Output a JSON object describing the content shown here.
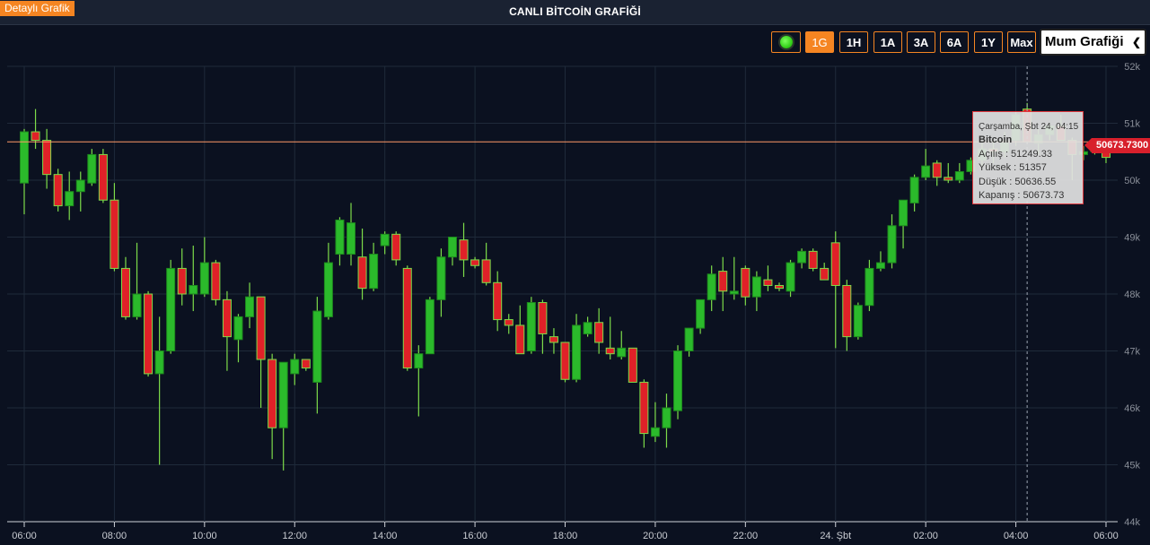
{
  "header": {
    "detail_button": "Detaylı Grafik",
    "title": "CANLI BİTCOİN GRAFİĞİ"
  },
  "toolbar": {
    "ranges": [
      "1G",
      "1H",
      "1A",
      "3A",
      "6A",
      "1Y",
      "Max"
    ],
    "active_range": "1G",
    "chart_type": "Mum Grafiği"
  },
  "tooltip": {
    "date": "Çarşamba, Şbt 24, 04:15",
    "name": "Bitcoin",
    "open": "Açılış : 51249.33",
    "high": "Yüksek : 51357",
    "low": "Düşük : 50636.55",
    "close": "Kapanış : 50673.73"
  },
  "price_tag": "50673.7300",
  "colors": {
    "up": "#2bba2b",
    "down": "#e02128",
    "wick": "#7ddc4a",
    "accent": "#f58522",
    "price_line": "#ff9966"
  },
  "chart_data": {
    "type": "candlestick",
    "title": "CANLI BİTCOİN GRAFİĞİ",
    "series_name": "Bitcoin",
    "ylim": [
      44000,
      52000
    ],
    "y_ticks": [
      "44k",
      "45k",
      "46k",
      "47k",
      "48k",
      "49k",
      "50k",
      "51k",
      "52k"
    ],
    "y_tick_values": [
      44000,
      45000,
      46000,
      47000,
      48000,
      49000,
      50000,
      51000,
      52000
    ],
    "x_ticks": [
      "06:00",
      "08:00",
      "10:00",
      "12:00",
      "14:00",
      "16:00",
      "18:00",
      "20:00",
      "22:00",
      "24. Şbt",
      "02:00",
      "04:00",
      "06:00"
    ],
    "x_tick_hours": [
      0,
      2,
      4,
      6,
      8,
      10,
      12,
      14,
      16,
      18,
      20,
      22,
      24
    ],
    "last_price": 50673.73,
    "crosshair_hour": 22.25,
    "candles": [
      {
        "t": 0,
        "o": 49950,
        "h": 50900,
        "l": 49400,
        "c": 50850
      },
      {
        "t": 0.25,
        "o": 50850,
        "h": 51250,
        "l": 50550,
        "c": 50700
      },
      {
        "t": 0.5,
        "o": 50700,
        "h": 50900,
        "l": 49850,
        "c": 50100
      },
      {
        "t": 0.75,
        "o": 50100,
        "h": 50200,
        "l": 49450,
        "c": 49550
      },
      {
        "t": 1,
        "o": 49550,
        "h": 50150,
        "l": 49300,
        "c": 49800
      },
      {
        "t": 1.25,
        "o": 49800,
        "h": 50150,
        "l": 49450,
        "c": 50000
      },
      {
        "t": 1.5,
        "o": 49950,
        "h": 50550,
        "l": 49900,
        "c": 50450
      },
      {
        "t": 1.75,
        "o": 50450,
        "h": 50550,
        "l": 49600,
        "c": 49650
      },
      {
        "t": 2,
        "o": 49650,
        "h": 49950,
        "l": 48400,
        "c": 48450
      },
      {
        "t": 2.25,
        "o": 48450,
        "h": 48650,
        "l": 47550,
        "c": 47600
      },
      {
        "t": 2.5,
        "o": 47600,
        "h": 48900,
        "l": 47550,
        "c": 48000
      },
      {
        "t": 2.75,
        "o": 48000,
        "h": 48050,
        "l": 46550,
        "c": 46600
      },
      {
        "t": 3,
        "o": 46600,
        "h": 47600,
        "l": 45000,
        "c": 47000
      },
      {
        "t": 3.25,
        "o": 47000,
        "h": 48600,
        "l": 46950,
        "c": 48450
      },
      {
        "t": 3.5,
        "o": 48450,
        "h": 48800,
        "l": 47800,
        "c": 48000
      },
      {
        "t": 3.75,
        "o": 48000,
        "h": 48850,
        "l": 47700,
        "c": 48150
      },
      {
        "t": 4,
        "o": 48000,
        "h": 49000,
        "l": 47950,
        "c": 48550
      },
      {
        "t": 4.25,
        "o": 48550,
        "h": 48600,
        "l": 47800,
        "c": 47900
      },
      {
        "t": 4.5,
        "o": 47900,
        "h": 48050,
        "l": 46650,
        "c": 47250
      },
      {
        "t": 4.75,
        "o": 47200,
        "h": 47650,
        "l": 46800,
        "c": 47600
      },
      {
        "t": 5,
        "o": 47600,
        "h": 48200,
        "l": 47400,
        "c": 47950
      },
      {
        "t": 5.25,
        "o": 47950,
        "h": 47950,
        "l": 46000,
        "c": 46850
      },
      {
        "t": 5.5,
        "o": 46850,
        "h": 46950,
        "l": 45100,
        "c": 45650
      },
      {
        "t": 5.75,
        "o": 45650,
        "h": 46800,
        "l": 44900,
        "c": 46800
      },
      {
        "t": 6,
        "o": 46600,
        "h": 46950,
        "l": 46400,
        "c": 46850
      },
      {
        "t": 6.25,
        "o": 46850,
        "h": 46850,
        "l": 46650,
        "c": 46700
      },
      {
        "t": 6.5,
        "o": 46450,
        "h": 47950,
        "l": 45900,
        "c": 47700
      },
      {
        "t": 6.75,
        "o": 47600,
        "h": 48900,
        "l": 47550,
        "c": 48550
      },
      {
        "t": 7,
        "o": 48700,
        "h": 49350,
        "l": 48500,
        "c": 49300
      },
      {
        "t": 7.25,
        "o": 48700,
        "h": 49600,
        "l": 48500,
        "c": 49250
      },
      {
        "t": 7.5,
        "o": 48650,
        "h": 49150,
        "l": 47900,
        "c": 48100
      },
      {
        "t": 7.75,
        "o": 48100,
        "h": 48900,
        "l": 48050,
        "c": 48700
      },
      {
        "t": 8,
        "o": 48850,
        "h": 49100,
        "l": 48700,
        "c": 49050
      },
      {
        "t": 8.25,
        "o": 49050,
        "h": 49100,
        "l": 48500,
        "c": 48600
      },
      {
        "t": 8.5,
        "o": 48450,
        "h": 48500,
        "l": 46650,
        "c": 46700
      },
      {
        "t": 8.75,
        "o": 46700,
        "h": 47100,
        "l": 45850,
        "c": 46950
      },
      {
        "t": 9,
        "o": 46950,
        "h": 47950,
        "l": 46950,
        "c": 47900
      },
      {
        "t": 9.25,
        "o": 47900,
        "h": 48800,
        "l": 47600,
        "c": 48650
      },
      {
        "t": 9.5,
        "o": 48650,
        "h": 49000,
        "l": 48500,
        "c": 49000
      },
      {
        "t": 9.75,
        "o": 48950,
        "h": 49250,
        "l": 48300,
        "c": 48600
      },
      {
        "t": 10,
        "o": 48600,
        "h": 48650,
        "l": 48450,
        "c": 48500
      },
      {
        "t": 10.25,
        "o": 48600,
        "h": 48900,
        "l": 48150,
        "c": 48200
      },
      {
        "t": 10.5,
        "o": 48200,
        "h": 48400,
        "l": 47350,
        "c": 47550
      },
      {
        "t": 10.75,
        "o": 47550,
        "h": 47650,
        "l": 47300,
        "c": 47450
      },
      {
        "t": 11,
        "o": 47450,
        "h": 47800,
        "l": 46950,
        "c": 46950
      },
      {
        "t": 11.25,
        "o": 47000,
        "h": 47950,
        "l": 46950,
        "c": 47850
      },
      {
        "t": 11.5,
        "o": 47850,
        "h": 47900,
        "l": 46950,
        "c": 47300
      },
      {
        "t": 11.75,
        "o": 47250,
        "h": 47400,
        "l": 46950,
        "c": 47150
      },
      {
        "t": 12,
        "o": 47150,
        "h": 47150,
        "l": 46450,
        "c": 46500
      },
      {
        "t": 12.25,
        "o": 46500,
        "h": 47650,
        "l": 46450,
        "c": 47450
      },
      {
        "t": 12.5,
        "o": 47300,
        "h": 47600,
        "l": 47250,
        "c": 47500
      },
      {
        "t": 12.75,
        "o": 47500,
        "h": 47750,
        "l": 46950,
        "c": 47150
      },
      {
        "t": 13,
        "o": 47050,
        "h": 47600,
        "l": 46850,
        "c": 46950
      },
      {
        "t": 13.25,
        "o": 46900,
        "h": 47350,
        "l": 46850,
        "c": 47050
      },
      {
        "t": 13.5,
        "o": 47050,
        "h": 47050,
        "l": 46450,
        "c": 46450
      },
      {
        "t": 13.75,
        "o": 46450,
        "h": 46500,
        "l": 45300,
        "c": 45550
      },
      {
        "t": 14,
        "o": 45500,
        "h": 46100,
        "l": 45400,
        "c": 45650
      },
      {
        "t": 14.25,
        "o": 45650,
        "h": 46250,
        "l": 45300,
        "c": 46000
      },
      {
        "t": 14.5,
        "o": 45950,
        "h": 47100,
        "l": 45800,
        "c": 47000
      },
      {
        "t": 14.75,
        "o": 47000,
        "h": 47400,
        "l": 46900,
        "c": 47400
      },
      {
        "t": 15,
        "o": 47400,
        "h": 47900,
        "l": 47300,
        "c": 47900
      },
      {
        "t": 15.25,
        "o": 47900,
        "h": 48500,
        "l": 47700,
        "c": 48350
      },
      {
        "t": 15.5,
        "o": 48400,
        "h": 48650,
        "l": 47700,
        "c": 48050
      },
      {
        "t": 15.75,
        "o": 48000,
        "h": 48650,
        "l": 47900,
        "c": 48050
      },
      {
        "t": 16,
        "o": 48450,
        "h": 48500,
        "l": 47800,
        "c": 47950
      },
      {
        "t": 16.25,
        "o": 47950,
        "h": 48400,
        "l": 47700,
        "c": 48300
      },
      {
        "t": 16.5,
        "o": 48250,
        "h": 48500,
        "l": 48050,
        "c": 48150
      },
      {
        "t": 16.75,
        "o": 48150,
        "h": 48200,
        "l": 48050,
        "c": 48100
      },
      {
        "t": 17,
        "o": 48050,
        "h": 48600,
        "l": 47950,
        "c": 48550
      },
      {
        "t": 17.25,
        "o": 48550,
        "h": 48800,
        "l": 48450,
        "c": 48750
      },
      {
        "t": 17.5,
        "o": 48750,
        "h": 48800,
        "l": 48400,
        "c": 48450
      },
      {
        "t": 17.75,
        "o": 48450,
        "h": 48550,
        "l": 48250,
        "c": 48250
      },
      {
        "t": 18,
        "o": 48900,
        "h": 49100,
        "l": 47050,
        "c": 48150
      },
      {
        "t": 18.25,
        "o": 48150,
        "h": 48250,
        "l": 47000,
        "c": 47250
      },
      {
        "t": 18.5,
        "o": 47250,
        "h": 47850,
        "l": 47200,
        "c": 47800
      },
      {
        "t": 18.75,
        "o": 47800,
        "h": 48600,
        "l": 47700,
        "c": 48450
      },
      {
        "t": 19,
        "o": 48450,
        "h": 48750,
        "l": 48400,
        "c": 48550
      },
      {
        "t": 19.25,
        "o": 48550,
        "h": 49400,
        "l": 48450,
        "c": 49200
      },
      {
        "t": 19.5,
        "o": 49200,
        "h": 49550,
        "l": 48800,
        "c": 49650
      },
      {
        "t": 19.75,
        "o": 49600,
        "h": 50100,
        "l": 49450,
        "c": 50050
      },
      {
        "t": 20,
        "o": 50050,
        "h": 50550,
        "l": 50000,
        "c": 50250
      },
      {
        "t": 20.25,
        "o": 50300,
        "h": 50350,
        "l": 49900,
        "c": 50050
      },
      {
        "t": 20.5,
        "o": 50050,
        "h": 50300,
        "l": 49950,
        "c": 50000
      },
      {
        "t": 20.75,
        "o": 50000,
        "h": 50300,
        "l": 49950,
        "c": 50150
      },
      {
        "t": 21,
        "o": 50150,
        "h": 50400,
        "l": 50100,
        "c": 50350
      },
      {
        "t": 21.25,
        "o": 50350,
        "h": 50650,
        "l": 50250,
        "c": 50550
      },
      {
        "t": 21.5,
        "o": 50550,
        "h": 50700,
        "l": 50300,
        "c": 50500
      },
      {
        "t": 21.75,
        "o": 50500,
        "h": 50850,
        "l": 50400,
        "c": 50700
      },
      {
        "t": 22,
        "o": 50700,
        "h": 51200,
        "l": 50600,
        "c": 51150
      },
      {
        "t": 22.25,
        "o": 51249.33,
        "h": 51357,
        "l": 50636.55,
        "c": 50673.73
      },
      {
        "t": 22.5,
        "o": 50650,
        "h": 50900,
        "l": 50450,
        "c": 50800
      },
      {
        "t": 22.75,
        "o": 50800,
        "h": 51000,
        "l": 50700,
        "c": 50950
      },
      {
        "t": 23,
        "o": 50950,
        "h": 51150,
        "l": 50700,
        "c": 50700
      },
      {
        "t": 23.25,
        "o": 50700,
        "h": 50750,
        "l": 50000,
        "c": 50450
      },
      {
        "t": 23.5,
        "o": 50450,
        "h": 50600,
        "l": 50350,
        "c": 50500
      },
      {
        "t": 23.75,
        "o": 50500,
        "h": 50600,
        "l": 50450,
        "c": 50550
      },
      {
        "t": 24,
        "o": 50500,
        "h": 50600,
        "l": 50300,
        "c": 50400
      }
    ]
  }
}
